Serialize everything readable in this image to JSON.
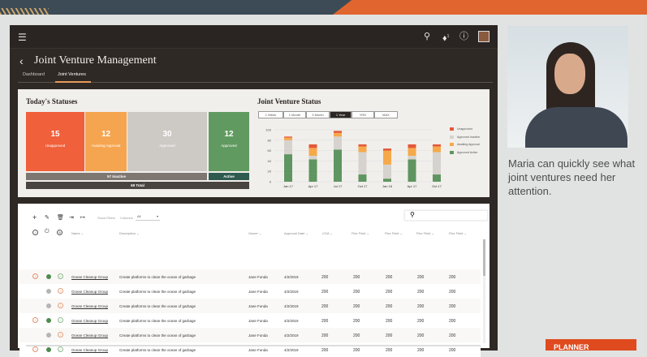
{
  "header": {
    "notification_count": "1"
  },
  "page": {
    "title": "Joint Venture Management",
    "tabs": [
      "Dashboard",
      "Joint Ventures"
    ],
    "active_tab": "Joint Ventures"
  },
  "statuses": {
    "title": "Today's Statuses",
    "tiles": [
      {
        "value": "15",
        "label": "Unapproved",
        "color": "#f0603a"
      },
      {
        "value": "12",
        "label": "Awaiting Approval",
        "color": "#f5a54f"
      },
      {
        "value": "30",
        "label": "Approved",
        "color": "#cdcac6"
      },
      {
        "value": "12",
        "label": "Approved",
        "color": "#619a60"
      }
    ],
    "inactive": "57 Inactive",
    "active": "Active",
    "total": "69 Total"
  },
  "chart_data": {
    "type": "bar",
    "stacked": true,
    "title": "Joint Venture Status",
    "ranges": [
      "1 Week",
      "1 Month",
      "3 Month",
      "1 Year",
      "YRD",
      "MAX"
    ],
    "selected_range": "1 Year",
    "categories": [
      "Jan 17",
      "Apr 17",
      "Jul 17",
      "Oct 17",
      "Jan 18",
      "Apr 17",
      "Oct 17"
    ],
    "ylim": [
      0,
      100
    ],
    "yticks": [
      0,
      20,
      40,
      60,
      80,
      100
    ],
    "legend_position": "right",
    "series": [
      {
        "name": "Approved Active",
        "color": "#5f9560",
        "values": [
          53,
          43,
          62,
          14,
          6,
          43,
          14
        ]
      },
      {
        "name": "Approved Inactive",
        "color": "#d6d3cf",
        "values": [
          27,
          7,
          25,
          43,
          27,
          7,
          43
        ]
      },
      {
        "name": "Awaiting Approval",
        "color": "#f6a94b",
        "values": [
          5,
          15,
          7,
          11,
          27,
          15,
          11
        ]
      },
      {
        "name": "Unapproved",
        "color": "#e5583a",
        "values": [
          2,
          7,
          4,
          4,
          4,
          7,
          4
        ]
      }
    ],
    "legend_order": [
      "Unapproved",
      "Approved Inactive",
      "Awaiting Approval",
      "Approved Active"
    ]
  },
  "table": {
    "show_filters": "Show Filters",
    "columns_label": "Columns",
    "columns_value": "All",
    "headers": [
      "Name",
      "Description",
      "Owner",
      "Approval Date",
      "COA",
      "Flex Field",
      "Flex Field",
      "Flex Field",
      "Flex Field"
    ],
    "rows": [
      {
        "warn": true,
        "status": "green",
        "check": "ok",
        "name": "Ocean Cleanup Group",
        "desc": "Create platforms to clean the ocean of garbage",
        "owner": "Jane Fonda",
        "date": "4/2/2019",
        "v": [
          "200",
          "200",
          "200",
          "200",
          "200"
        ]
      },
      {
        "warn": false,
        "status": "grey",
        "check": "x",
        "name": "Ocean Cleanup Group",
        "desc": "Create platforms to clean the ocean of garbage",
        "owner": "Jane Fonda",
        "date": "4/2/2019",
        "v": [
          "200",
          "200",
          "200",
          "200",
          "200"
        ]
      },
      {
        "warn": false,
        "status": "grey",
        "check": "warn",
        "name": "Ocean Cleanup Group",
        "desc": "Create platforms to clean the ocean of garbage",
        "owner": "Jane Fonda",
        "date": "4/2/2019",
        "v": [
          "200",
          "200",
          "200",
          "200",
          "200"
        ]
      },
      {
        "warn": true,
        "status": "green",
        "check": "ok",
        "name": "Ocean Cleanup Group",
        "desc": "Create platforms to clean the ocean of garbage",
        "owner": "Jane Fonda",
        "date": "4/2/2019",
        "v": [
          "200",
          "200",
          "200",
          "200",
          "200"
        ]
      },
      {
        "warn": false,
        "status": "grey",
        "check": "warn",
        "name": "Ocean Cleanup Group",
        "desc": "Create platforms to clean the ocean of garbage",
        "owner": "Jane Fonda",
        "date": "4/2/2019",
        "v": [
          "200",
          "200",
          "200",
          "200",
          "200"
        ]
      },
      {
        "warn": true,
        "status": "green",
        "check": "ok",
        "name": "Ocean Cleanup Group",
        "desc": "Create platforms to clean the ocean of garbage",
        "owner": "Jane Fonda",
        "date": "4/2/2019",
        "v": [
          "200",
          "200",
          "200",
          "200",
          "200"
        ]
      }
    ]
  },
  "side": {
    "caption": "Maria can quickly see what joint ventures need her attention.",
    "badge": "PLANNER"
  }
}
